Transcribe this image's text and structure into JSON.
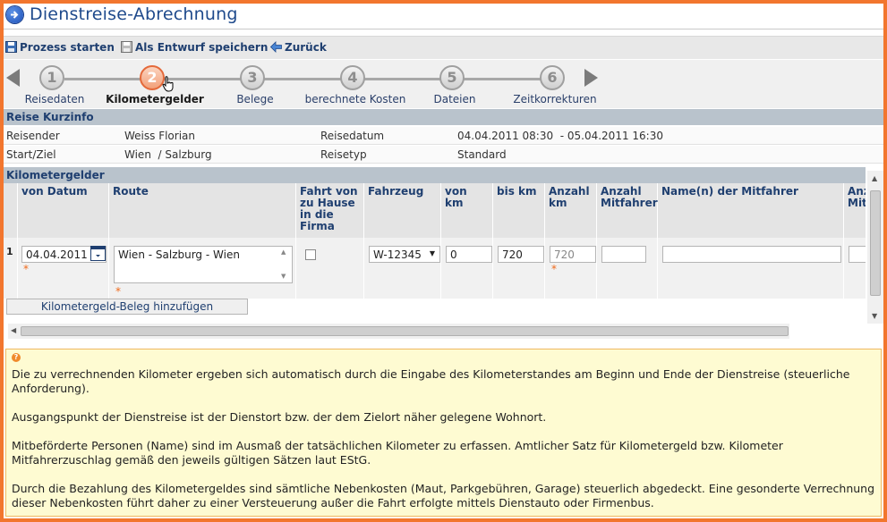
{
  "window": {
    "title": "Dienstreise-Abrechnung",
    "title_icon": "forward-circle-icon"
  },
  "toolbar": {
    "start_label": "Prozess starten",
    "draft_label": "Als Entwurf speichern",
    "back_label": "Zurück"
  },
  "steps": [
    {
      "number": "1",
      "label": "Reisedaten"
    },
    {
      "number": "2",
      "label": "Kilometergelder",
      "active": true
    },
    {
      "number": "3",
      "label": "Belege"
    },
    {
      "number": "4",
      "label": "berechnete Kosten"
    },
    {
      "number": "5",
      "label": "Dateien"
    },
    {
      "number": "6",
      "label": "Zeitkorrekturen"
    }
  ],
  "kurzinfo": {
    "header": "Reise Kurzinfo",
    "reisender_label": "Reisender",
    "reisender_value": "Weiss Florian",
    "reisedatum_label": "Reisedatum",
    "reisedatum_value": "04.04.2011 08:30  - 05.04.2011 16:30",
    "startziel_label": "Start/Ziel",
    "startziel_value": "Wien  / Salzburg",
    "reisetyp_label": "Reisetyp",
    "reisetyp_value": "Standard"
  },
  "km": {
    "header": "Kilometergelder",
    "columns": {
      "von_datum": "von Datum",
      "route": "Route",
      "fahrt": "Fahrt von zu Hause in die Firma",
      "fahrzeug": "Fahrzeug",
      "von_km": "von km",
      "bis_km": "bis km",
      "anzahl_km": "Anzahl km",
      "anzahl_mitfahrer": "Anzahl Mitfahrer",
      "namen": "Name(n) der Mitfahrer",
      "cut": "Anz Mit"
    },
    "row": {
      "num": "1",
      "von_datum": "04.04.2011",
      "route": "Wien - Salzburg - Wien",
      "fahrzeug": "W-12345",
      "von_km": "0",
      "bis_km": "720",
      "anzahl_km": "720",
      "anzahl_mitfahrer": "",
      "namen": "",
      "required_mark": "*"
    },
    "add_button": "Kilometergeld-Beleg hinzufügen"
  },
  "help": {
    "icon": "help-icon",
    "paragraphs": [
      "Die zu verrechnenden Kilometer ergeben sich automatisch durch die Eingabe des Kilometerstandes am Beginn und Ende der Dienstreise (steuerliche Anforderung).",
      "Ausgangspunkt der Dienstreise ist der Dienstort bzw. der dem Zielort näher gelegene Wohnort.",
      "Mitbeförderte Personen (Name) sind im Ausmaß der tatsächlichen Kilometer zu erfassen. Amtlicher Satz für Kilometergeld bzw. Kilometer Mitfahrerzuschlag gemäß den jeweils gültigen Sätzen laut EStG.",
      "Durch die Bezahlung des Kilometergeldes sind sämtliche Nebenkosten (Maut, Parkgebühren, Garage) steuerlich abgedeckt. Eine gesonderte Verrechnung dieser Nebenkosten führt daher zu einer Versteuerung außer die Fahrt erfolgte mittels Dienstauto oder Firmenbus."
    ]
  },
  "colors": {
    "frame": "#f2762e",
    "accent": "#e4693a",
    "header_bg": "#b9c3cc"
  }
}
